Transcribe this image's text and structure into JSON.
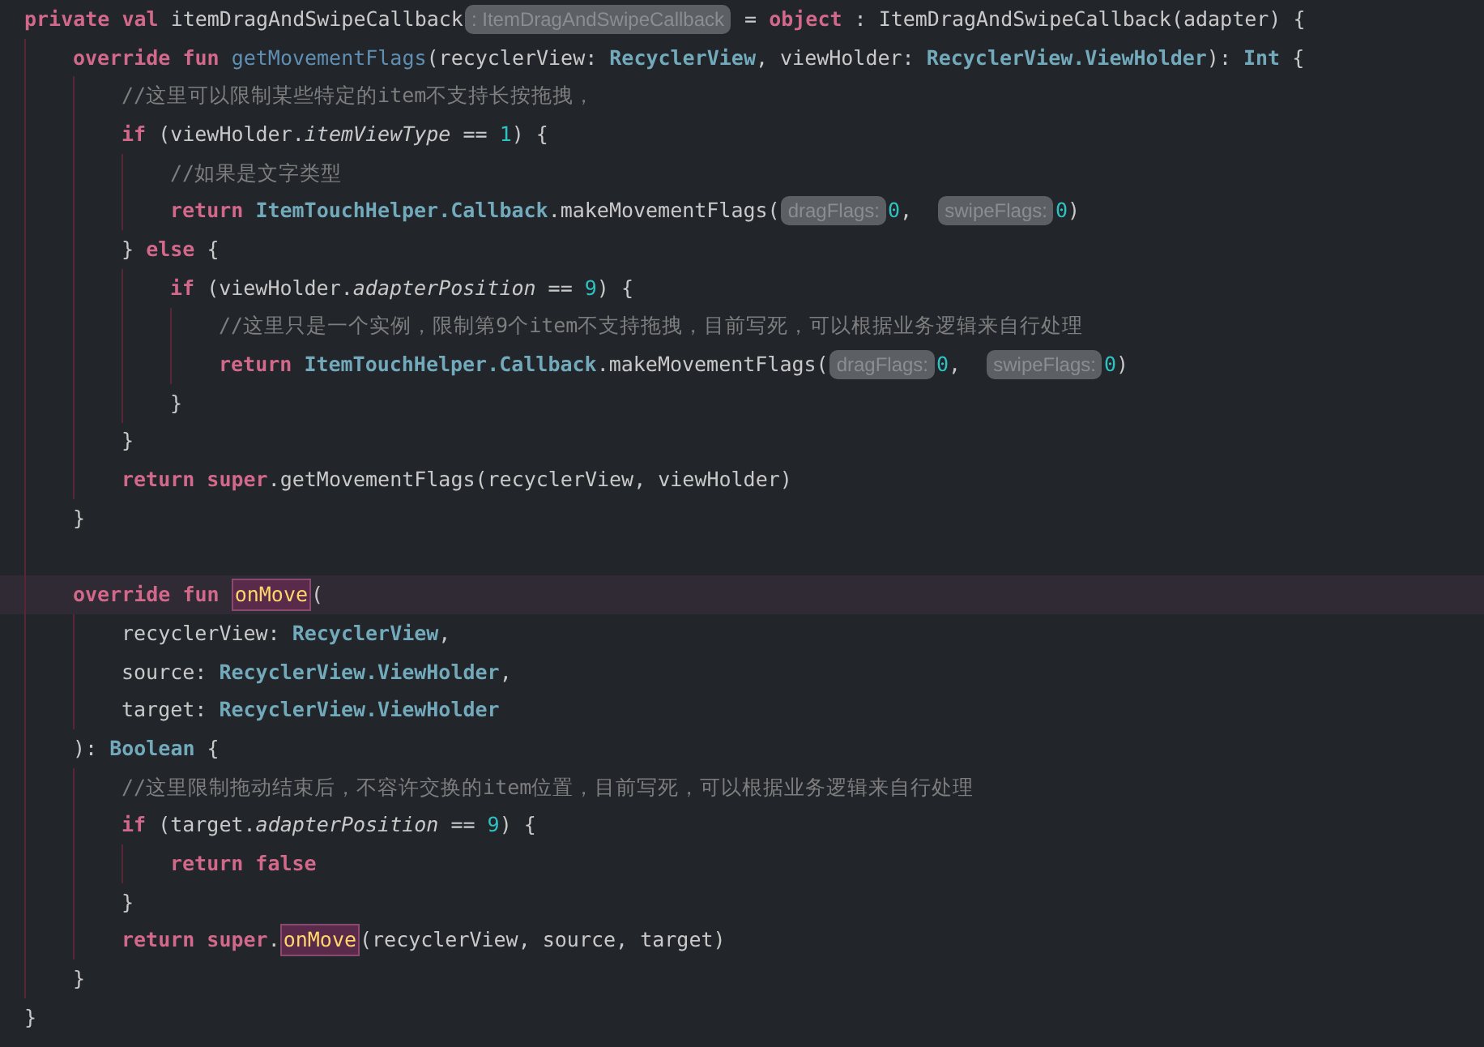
{
  "editor": {
    "lines": [
      {
        "current": false,
        "tokens": [
          {
            "kind": "keyword",
            "text": "private val "
          },
          {
            "kind": "plain",
            "text": "itemDragAndSwipeCallback"
          },
          {
            "kind": "hint",
            "text": ": ItemDragAndSwipeCallback"
          },
          {
            "kind": "plain",
            "text": " = "
          },
          {
            "kind": "keyword",
            "text": "object"
          },
          {
            "kind": "plain",
            "text": " : ItemDragAndSwipeCallback(adapter) {"
          }
        ],
        "children": [
          {
            "current": false,
            "tokens": [
              {
                "kind": "keyword",
                "text": "override fun "
              },
              {
                "kind": "function",
                "text": "getMovementFlags"
              },
              {
                "kind": "plain",
                "text": "(recyclerView: "
              },
              {
                "kind": "type",
                "text": "RecyclerView"
              },
              {
                "kind": "plain",
                "text": ", viewHolder: "
              },
              {
                "kind": "type",
                "text": "RecyclerView.ViewHolder"
              },
              {
                "kind": "plain",
                "text": "): "
              },
              {
                "kind": "type",
                "text": "Int"
              },
              {
                "kind": "plain",
                "text": " {"
              }
            ],
            "children": [
              {
                "current": false,
                "tokens": [
                  {
                    "kind": "comment",
                    "text": "//这里可以限制某些特定的item不支持长按拖拽，"
                  }
                ]
              },
              {
                "current": false,
                "tokens": [
                  {
                    "kind": "keyword",
                    "text": "if "
                  },
                  {
                    "kind": "plain",
                    "text": "(viewHolder."
                  },
                  {
                    "kind": "property",
                    "text": "itemViewType"
                  },
                  {
                    "kind": "plain",
                    "text": " == "
                  },
                  {
                    "kind": "number",
                    "text": "1"
                  },
                  {
                    "kind": "plain",
                    "text": ") {"
                  }
                ],
                "children": [
                  {
                    "current": false,
                    "tokens": [
                      {
                        "kind": "comment",
                        "text": "//如果是文字类型"
                      }
                    ]
                  },
                  {
                    "current": false,
                    "tokens": [
                      {
                        "kind": "keyword",
                        "text": "return "
                      },
                      {
                        "kind": "type",
                        "text": "ItemTouchHelper.Callback"
                      },
                      {
                        "kind": "plain",
                        "text": ".makeMovementFlags("
                      },
                      {
                        "kind": "hint",
                        "text": "dragFlags:"
                      },
                      {
                        "kind": "number",
                        "text": "0"
                      },
                      {
                        "kind": "plain",
                        "text": ",  "
                      },
                      {
                        "kind": "hint",
                        "text": "swipeFlags:"
                      },
                      {
                        "kind": "number",
                        "text": "0"
                      },
                      {
                        "kind": "plain",
                        "text": ")"
                      }
                    ]
                  }
                ]
              },
              {
                "current": false,
                "tokens": [
                  {
                    "kind": "plain",
                    "text": "} "
                  },
                  {
                    "kind": "keyword",
                    "text": "else"
                  },
                  {
                    "kind": "plain",
                    "text": " {"
                  }
                ],
                "children": [
                  {
                    "current": false,
                    "tokens": [
                      {
                        "kind": "keyword",
                        "text": "if "
                      },
                      {
                        "kind": "plain",
                        "text": "(viewHolder."
                      },
                      {
                        "kind": "property",
                        "text": "adapterPosition"
                      },
                      {
                        "kind": "plain",
                        "text": " == "
                      },
                      {
                        "kind": "number",
                        "text": "9"
                      },
                      {
                        "kind": "plain",
                        "text": ") {"
                      }
                    ],
                    "children": [
                      {
                        "current": false,
                        "tokens": [
                          {
                            "kind": "comment",
                            "text": "//这里只是一个实例，限制第9个item不支持拖拽，目前写死，可以根据业务逻辑来自行处理"
                          }
                        ]
                      },
                      {
                        "current": false,
                        "tokens": [
                          {
                            "kind": "keyword",
                            "text": "return "
                          },
                          {
                            "kind": "type",
                            "text": "ItemTouchHelper.Callback"
                          },
                          {
                            "kind": "plain",
                            "text": ".makeMovementFlags("
                          },
                          {
                            "kind": "hint",
                            "text": "dragFlags:"
                          },
                          {
                            "kind": "number",
                            "text": "0"
                          },
                          {
                            "kind": "plain",
                            "text": ",  "
                          },
                          {
                            "kind": "hint",
                            "text": "swipeFlags:"
                          },
                          {
                            "kind": "number",
                            "text": "0"
                          },
                          {
                            "kind": "plain",
                            "text": ")"
                          }
                        ]
                      }
                    ]
                  },
                  {
                    "current": false,
                    "tokens": [
                      {
                        "kind": "plain",
                        "text": "}"
                      }
                    ]
                  }
                ]
              },
              {
                "current": false,
                "tokens": [
                  {
                    "kind": "plain",
                    "text": "}"
                  }
                ]
              },
              {
                "current": false,
                "tokens": [
                  {
                    "kind": "keyword",
                    "text": "return super"
                  },
                  {
                    "kind": "plain",
                    "text": ".getMovementFlags(recyclerView, viewHolder)"
                  }
                ]
              }
            ]
          },
          {
            "current": false,
            "tokens": [
              {
                "kind": "plain",
                "text": "}"
              }
            ]
          },
          {
            "current": false
          },
          {
            "current": true,
            "tokens": [
              {
                "kind": "keyword",
                "text": "override fun "
              },
              {
                "kind": "usage",
                "text": "onMove"
              },
              {
                "kind": "plain",
                "text": "("
              }
            ],
            "children": [
              {
                "current": false,
                "tokens": [
                  {
                    "kind": "plain",
                    "text": "recyclerView: "
                  },
                  {
                    "kind": "type",
                    "text": "RecyclerView"
                  },
                  {
                    "kind": "plain",
                    "text": ","
                  }
                ]
              },
              {
                "current": false,
                "tokens": [
                  {
                    "kind": "plain",
                    "text": "source: "
                  },
                  {
                    "kind": "type",
                    "text": "RecyclerView.ViewHolder"
                  },
                  {
                    "kind": "plain",
                    "text": ","
                  }
                ]
              },
              {
                "current": false,
                "tokens": [
                  {
                    "kind": "plain",
                    "text": "target: "
                  },
                  {
                    "kind": "type",
                    "text": "RecyclerView.ViewHolder"
                  }
                ]
              }
            ]
          },
          {
            "current": false,
            "tokens": [
              {
                "kind": "plain",
                "text": "): "
              },
              {
                "kind": "type",
                "text": "Boolean"
              },
              {
                "kind": "plain",
                "text": " {"
              }
            ],
            "children": [
              {
                "current": false,
                "tokens": [
                  {
                    "kind": "comment",
                    "text": "//这里限制拖动结束后，不容许交换的item位置，目前写死，可以根据业务逻辑来自行处理"
                  }
                ]
              },
              {
                "current": false,
                "tokens": [
                  {
                    "kind": "keyword",
                    "text": "if "
                  },
                  {
                    "kind": "plain",
                    "text": "(target."
                  },
                  {
                    "kind": "property",
                    "text": "adapterPosition"
                  },
                  {
                    "kind": "plain",
                    "text": " == "
                  },
                  {
                    "kind": "number",
                    "text": "9"
                  },
                  {
                    "kind": "plain",
                    "text": ") {"
                  }
                ],
                "children": [
                  {
                    "current": false,
                    "tokens": [
                      {
                        "kind": "keyword",
                        "text": "return false"
                      }
                    ]
                  }
                ]
              },
              {
                "current": false,
                "tokens": [
                  {
                    "kind": "plain",
                    "text": "}"
                  }
                ]
              },
              {
                "current": false,
                "tokens": [
                  {
                    "kind": "keyword",
                    "text": "return super"
                  },
                  {
                    "kind": "plain",
                    "text": "."
                  },
                  {
                    "kind": "usage",
                    "text": "onMove"
                  },
                  {
                    "kind": "plain",
                    "text": "(recyclerView, source, target)"
                  }
                ]
              }
            ]
          },
          {
            "current": false,
            "tokens": [
              {
                "kind": "plain",
                "text": "}"
              }
            ]
          }
        ]
      },
      {
        "current": false,
        "tokens": [
          {
            "kind": "plain",
            "text": "}"
          }
        ]
      }
    ]
  }
}
